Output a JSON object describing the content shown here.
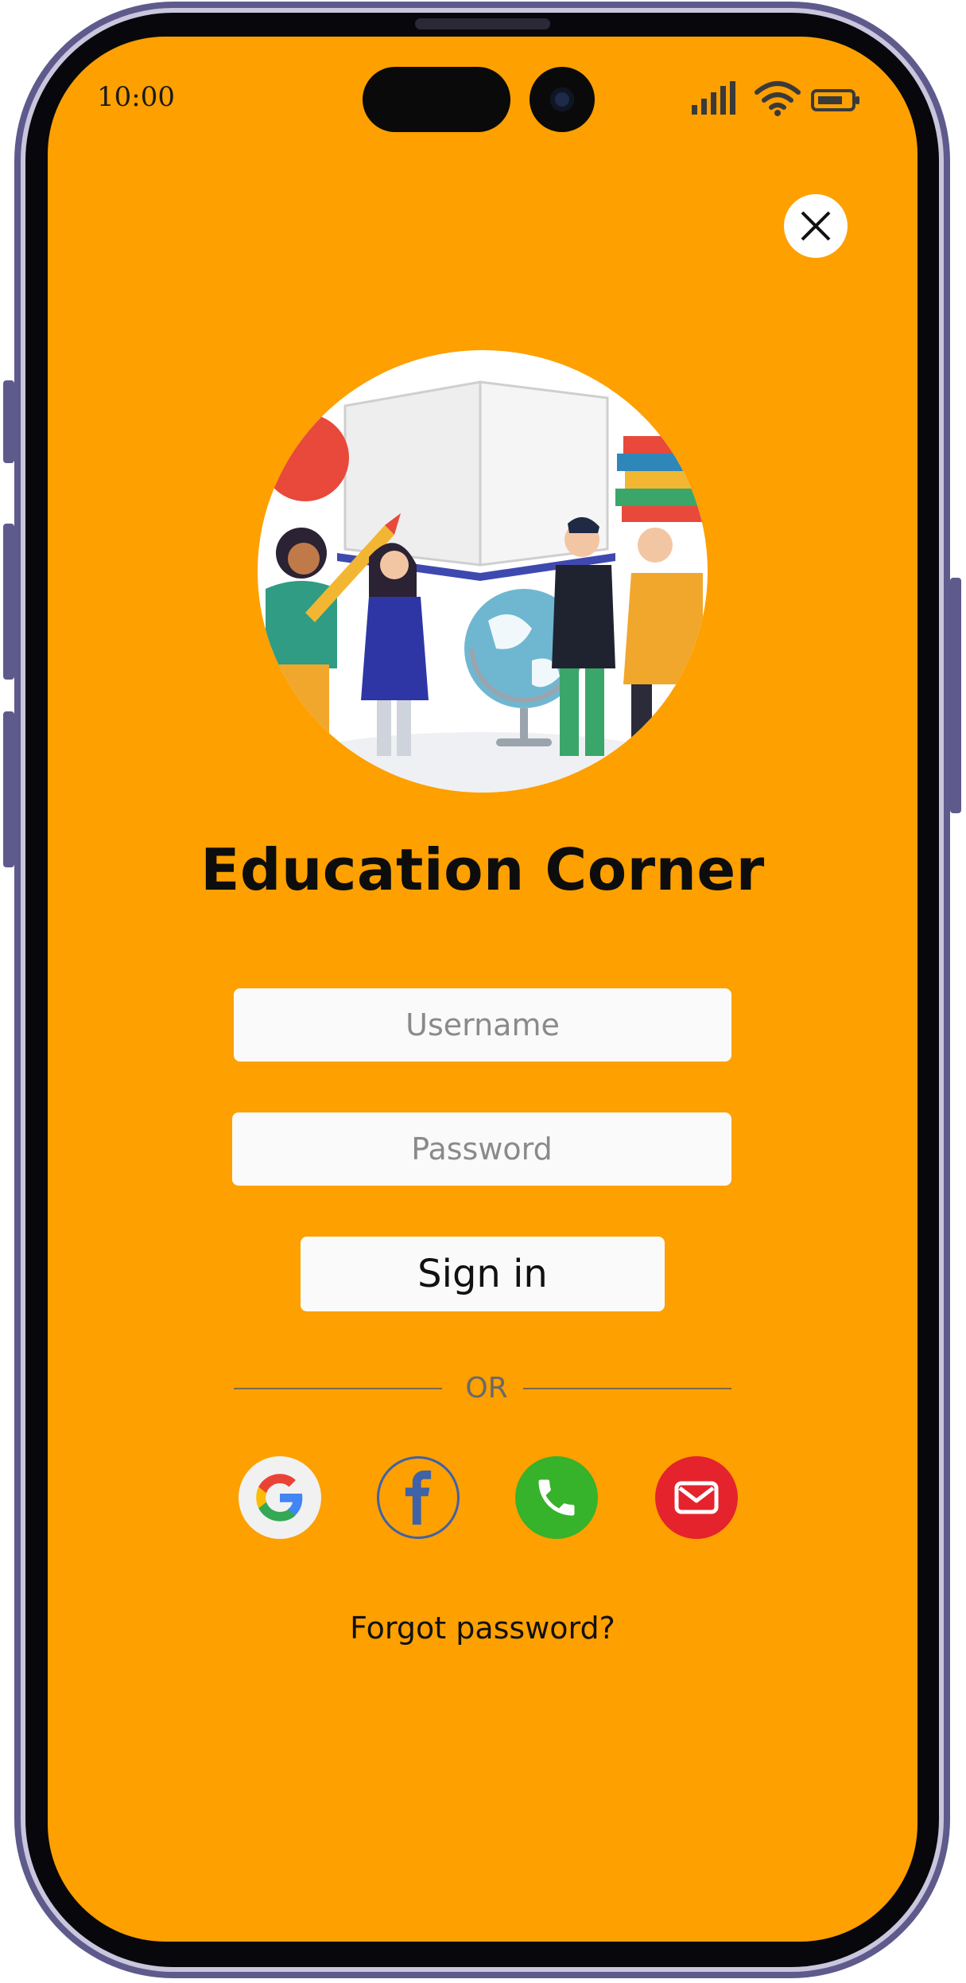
{
  "status_bar": {
    "time": "10:00",
    "icons": [
      "signal-icon",
      "wifi-icon",
      "battery-icon"
    ]
  },
  "header": {
    "close_icon": "close-icon"
  },
  "hero": {
    "image": "education-illustration"
  },
  "app": {
    "title": "Education Corner",
    "brand_color": "#fda000"
  },
  "form": {
    "username_placeholder": "Username",
    "password_placeholder": "Password",
    "signin_label": "Sign in"
  },
  "divider": {
    "label": "OR"
  },
  "social": [
    {
      "name": "google",
      "icon": "google-icon"
    },
    {
      "name": "facebook",
      "icon": "facebook-icon"
    },
    {
      "name": "phone",
      "icon": "phone-icon",
      "color": "#36b22b"
    },
    {
      "name": "email",
      "icon": "email-icon",
      "color": "#e5232d"
    }
  ],
  "links": {
    "forgot_password": "Forgot password?"
  }
}
